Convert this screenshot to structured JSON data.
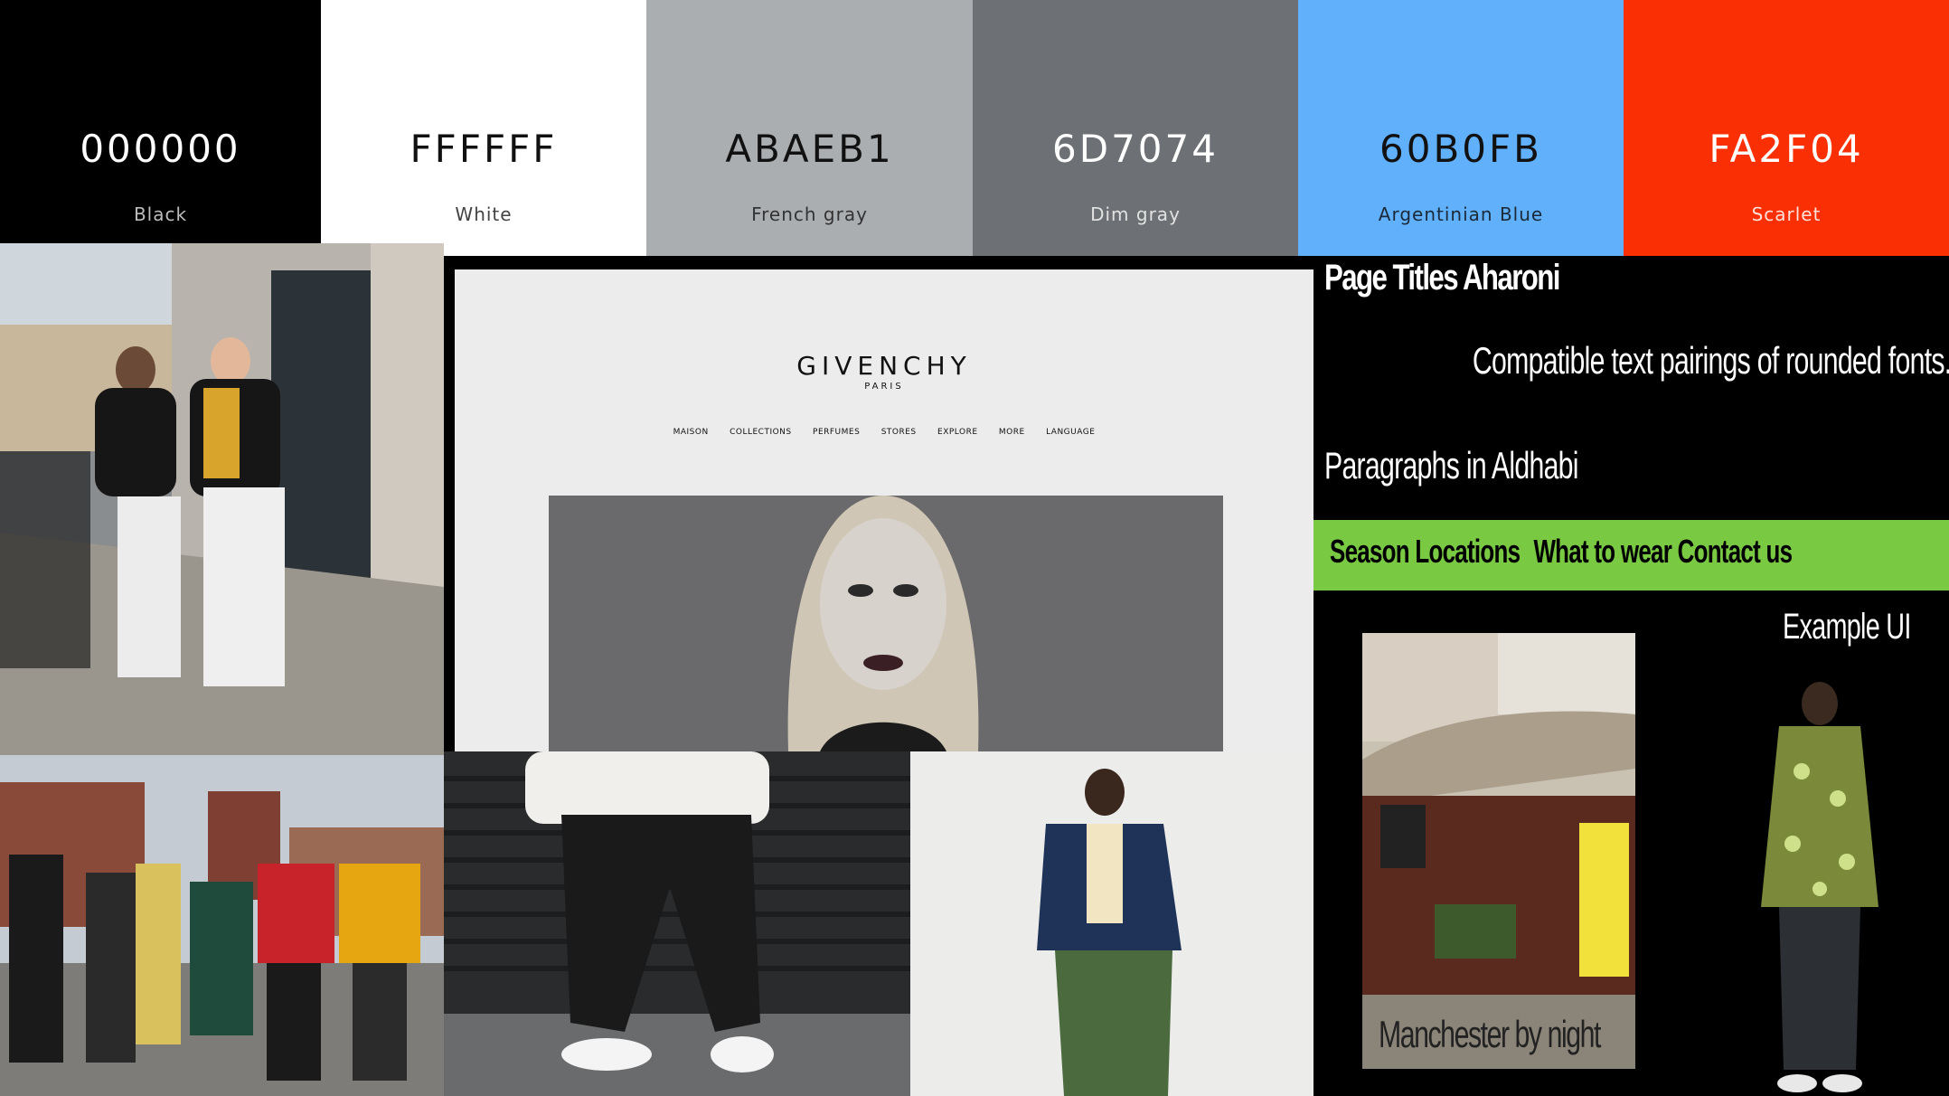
{
  "palette": [
    {
      "hex": "000000",
      "name": "Black",
      "color": "#000000",
      "text": "#ffffff",
      "sub": "#bcbcbc"
    },
    {
      "hex": "FFFFFF",
      "name": "White",
      "color": "#ffffff",
      "text": "#111111",
      "sub": "#444444"
    },
    {
      "hex": "ABAEB1",
      "name": "French gray",
      "color": "#abaeb1",
      "text": "#111111",
      "sub": "#333333"
    },
    {
      "hex": "6D7074",
      "name": "Dim gray",
      "color": "#6d7074",
      "text": "#ffffff",
      "sub": "#e2e2e2"
    },
    {
      "hex": "60B0FB",
      "name": "Argentinian Blue",
      "color": "#60b0fb",
      "text": "#111111",
      "sub": "#1b2a3a"
    },
    {
      "hex": "FA2F04",
      "name": "Scarlet",
      "color": "#fa2f04",
      "text": "#ffffff",
      "sub": "#fde1d9"
    }
  ],
  "website": {
    "brand": "GIVENCHY",
    "brand_sub": "PARIS",
    "nav": [
      "MAISON",
      "COLLECTIONS",
      "PERFUMES",
      "STORES",
      "EXPLORE",
      "MORE",
      "LANGUAGE"
    ]
  },
  "typography": {
    "page_titles": "Page Titles Aharoni",
    "pairings": "Compatible text pairings of rounded fonts.",
    "paragraphs": "Paragraphs in Aldhabi"
  },
  "example_nav": {
    "items": [
      "Season",
      "Locations",
      "What to wear",
      "Contact us"
    ],
    "bar_color": "#7ac943"
  },
  "example_ui": {
    "label": "Example UI",
    "caption": "Manchester by night"
  }
}
